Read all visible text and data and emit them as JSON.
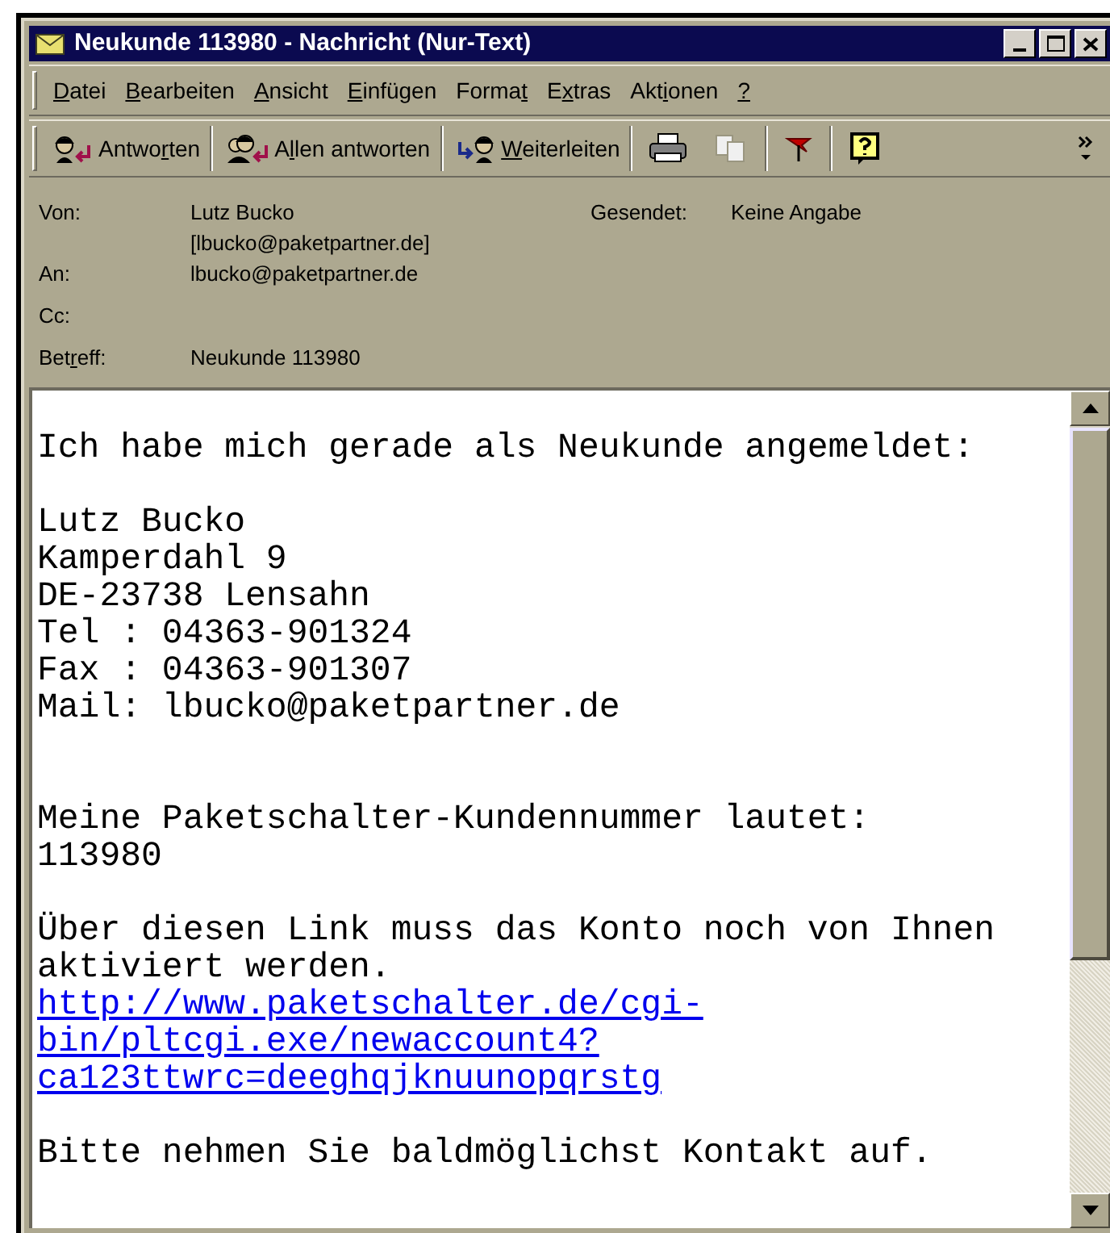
{
  "window": {
    "title": "Neukunde 113980 - Nachricht (Nur-Text)"
  },
  "menu": [
    {
      "key": "D",
      "after": "atei"
    },
    {
      "key": "B",
      "after": "earbeiten"
    },
    {
      "key": "A",
      "after": "nsicht"
    },
    {
      "key": "E",
      "after": "infügen"
    },
    {
      "before": "Forma",
      "key": "t"
    },
    {
      "before": "E",
      "key": "x",
      "after": "tras"
    },
    {
      "before": "Akt",
      "key": "i",
      "after": "onen"
    },
    {
      "key": "?"
    }
  ],
  "toolbar": [
    {
      "kind": "reply",
      "label": {
        "before": "Antwo",
        "key": "r",
        "after": "ten"
      }
    },
    {
      "kind": "reply_all",
      "label": {
        "before": "A",
        "key": "l",
        "after": "len antworten"
      }
    },
    {
      "kind": "forward",
      "label": {
        "key": "W",
        "after": "eiterleiten"
      }
    },
    {
      "kind": "print"
    },
    {
      "kind": "copy"
    },
    {
      "kind": "flag"
    },
    {
      "kind": "help"
    },
    {
      "kind": "more"
    }
  ],
  "header": {
    "fields": [
      {
        "label": {
          "before": "Von:"
        },
        "value": "Lutz Bucko [lbucko@paketpartner.de]"
      },
      {
        "label": {
          "before": "An:"
        },
        "value": "lbucko@paketpartner.de"
      },
      {
        "label": {
          "before": "Cc:"
        }
      },
      {
        "label": {
          "before": "Bet",
          "key": "r",
          "after": "eff:"
        },
        "value": "Neukunde 113980"
      }
    ],
    "sent": {
      "label": "Gesendet:",
      "value": "Keine Angabe"
    }
  },
  "body": {
    "lines": [
      {
        "kind": "blank"
      },
      {
        "kind": "text",
        "text": "Ich habe mich gerade als Neukunde angemeldet:"
      },
      {
        "kind": "blank"
      },
      {
        "kind": "text",
        "text": "Lutz Bucko"
      },
      {
        "kind": "text",
        "text": "Kamperdahl 9"
      },
      {
        "kind": "text",
        "text": "DE-23738 Lensahn"
      },
      {
        "kind": "text",
        "text": "Tel : 04363-901324"
      },
      {
        "kind": "text",
        "text": "Fax : 04363-901307"
      },
      {
        "kind": "text",
        "text": "Mail: lbucko@paketpartner.de"
      },
      {
        "kind": "blank"
      },
      {
        "kind": "blank"
      },
      {
        "kind": "text",
        "text": "Meine Paketschalter-Kundennummer lautet:"
      },
      {
        "kind": "text",
        "text": "113980"
      },
      {
        "kind": "blank"
      },
      {
        "kind": "text",
        "text": "Über diesen Link muss das Konto noch von Ihnen"
      },
      {
        "kind": "text",
        "text": "aktiviert werden."
      },
      {
        "kind": "link",
        "text": "http://www.paketschalter.de/cgi-"
      },
      {
        "kind": "link",
        "text": "bin/pltcgi.exe/newaccount4?"
      },
      {
        "kind": "link",
        "text": "ca123ttwrc=deeghqjknuunopqrstg"
      },
      {
        "kind": "blank"
      },
      {
        "kind": "text",
        "text": "Bitte nehmen Sie baldmöglichst Kontakt auf."
      }
    ]
  }
}
